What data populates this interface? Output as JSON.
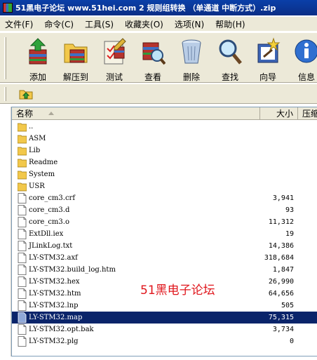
{
  "window": {
    "title": "51黑电子论坛 www.51hei.com 2 规则组转换 （单通道 中断方式）.zip"
  },
  "menu": [
    "文件(F)",
    "命令(C)",
    "工具(S)",
    "收藏夹(O)",
    "选项(N)",
    "帮助(H)"
  ],
  "toolbar": [
    {
      "label": "添加",
      "icon": "add-icon"
    },
    {
      "label": "解压到",
      "icon": "extract-to-icon"
    },
    {
      "label": "测试",
      "icon": "test-icon"
    },
    {
      "label": "查看",
      "icon": "view-icon"
    },
    {
      "label": "删除",
      "icon": "delete-icon"
    },
    {
      "label": "查找",
      "icon": "find-icon"
    },
    {
      "label": "向导",
      "icon": "wizard-icon"
    },
    {
      "label": "信息",
      "icon": "info-icon"
    }
  ],
  "columns": {
    "name": "名称",
    "size": "大小",
    "packed": "压缩"
  },
  "files": [
    {
      "name": "..",
      "size": "",
      "type": "folder"
    },
    {
      "name": "ASM",
      "size": "",
      "type": "folder"
    },
    {
      "name": "Lib",
      "size": "",
      "type": "folder"
    },
    {
      "name": "Readme",
      "size": "",
      "type": "folder"
    },
    {
      "name": "System",
      "size": "",
      "type": "folder"
    },
    {
      "name": "USR",
      "size": "",
      "type": "folder"
    },
    {
      "name": "core_cm3.crf",
      "size": "3,941",
      "type": "file"
    },
    {
      "name": "core_cm3.d",
      "size": "93",
      "type": "file"
    },
    {
      "name": "core_cm3.o",
      "size": "11,312",
      "type": "file"
    },
    {
      "name": "ExtDll.iex",
      "size": "19",
      "type": "file"
    },
    {
      "name": "JLinkLog.txt",
      "size": "14,386",
      "type": "file"
    },
    {
      "name": "LY-STM32.axf",
      "size": "318,684",
      "type": "file"
    },
    {
      "name": "LY-STM32.build_log.htm",
      "size": "1,847",
      "type": "file"
    },
    {
      "name": "LY-STM32.hex",
      "size": "26,990",
      "type": "file"
    },
    {
      "name": "LY-STM32.htm",
      "size": "64,656",
      "type": "file"
    },
    {
      "name": "LY-STM32.lnp",
      "size": "505",
      "type": "file"
    },
    {
      "name": "LY-STM32.map",
      "size": "75,315",
      "type": "file",
      "selected": true
    },
    {
      "name": "LY-STM32.opt.bak",
      "size": "3,734",
      "type": "file"
    },
    {
      "name": "LY-STM32.plg",
      "size": "0",
      "type": "file"
    }
  ],
  "watermark": "51黑电子论坛",
  "colors": {
    "selection": "#0a246a",
    "watermark": "#e0161c",
    "titlebar": "#0a3fa8"
  }
}
